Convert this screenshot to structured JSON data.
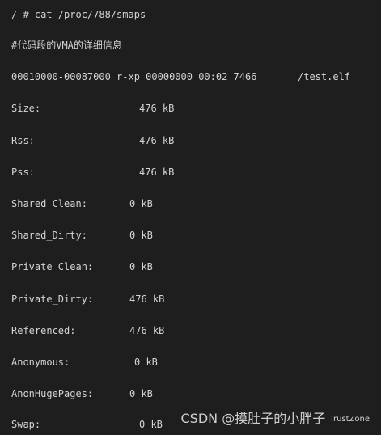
{
  "terminal": {
    "command": "/ # cat /proc/788/smaps",
    "comment": "#代码段的VMA的详细信息",
    "vma_line": "00010000-00087000 r-xp 00000000 00:02 7466       /test.elf",
    "fields": [
      {
        "key": "Size:",
        "value": "476 kB"
      },
      {
        "key": "Rss:",
        "value": "476 kB"
      },
      {
        "key": "Pss:",
        "value": "476 kB"
      },
      {
        "key": "Shared_Clean:",
        "value": "0 kB"
      },
      {
        "key": "Shared_Dirty:",
        "value": "0 kB"
      },
      {
        "key": "Private_Clean:",
        "value": "0 kB"
      },
      {
        "key": "Private_Dirty:",
        "value": "476 kB"
      },
      {
        "key": "Referenced:",
        "value": "476 kB"
      },
      {
        "key": "Anonymous:",
        "value": "0 kB"
      },
      {
        "key": "AnonHugePages:",
        "value": "0 kB"
      },
      {
        "key": "Swap:",
        "value": "0 kB"
      }
    ]
  },
  "watermark": {
    "text": "CSDN @摸肚子的小胖子",
    "overlay": "TrustZone"
  }
}
